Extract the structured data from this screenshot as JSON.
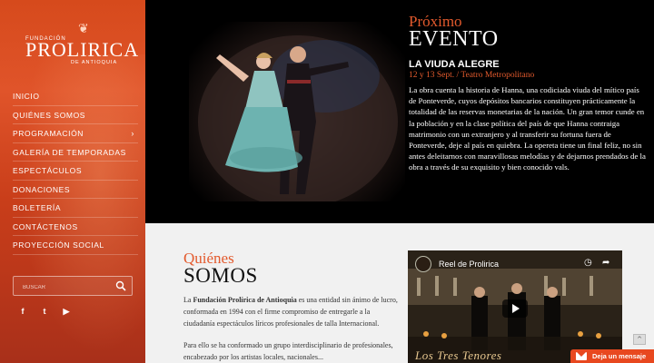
{
  "colors": {
    "accent": "#e35a2d",
    "sidebar": "#d64a1c",
    "event_bg": "#000000",
    "about_bg": "#f1f1f1"
  },
  "logo": {
    "top": "FUNDACIÓN",
    "main": "PROLIRICA",
    "sub": "DE ANTIOQUIA",
    "icon": "theatre-mask-icon"
  },
  "nav": {
    "items": [
      {
        "label": "INICIO"
      },
      {
        "label": "QUIÉNES SOMOS"
      },
      {
        "label": "PROGRAMACIÓN",
        "chevron": "›"
      },
      {
        "label": "GALERÍA DE TEMPORADAS"
      },
      {
        "label": "ESPECTÁCULOS"
      },
      {
        "label": "DONACIONES"
      },
      {
        "label": "BOLETERÍA"
      },
      {
        "label": "CONTÁCTENOS"
      },
      {
        "label": "PROYECCIÓN SOCIAL"
      }
    ]
  },
  "search": {
    "placeholder": "BUSCAR",
    "icon": "search-icon"
  },
  "social": {
    "facebook": "f",
    "twitter": "t",
    "youtube": "▶"
  },
  "event": {
    "kicker": "Próximo",
    "title": "EVENTO",
    "name": "LA VIUDA ALEGRE",
    "date": "12 y 13 Sept. / Teatro Metropolitano",
    "description": "La obra cuenta la historia de Hanna, una codiciada viuda del mítico país de Ponteverde, cuyos depósitos bancarios constituyen prácticamente la totalidad de las reservas monetarias de la nación. Un gran temor cunde en la población y en la clase política del país de que Hanna contraiga matrimonio con un extranjero y al transferir su fortuna fuera de Ponteverde, deje al país en quiebra. La opereta tiene un final feliz, no sin antes deleitarnos con maravillosas melodías y de dejarnos prendados de la obra a través de su exquisito y bien conocido vals."
  },
  "about": {
    "kicker": "Quiénes",
    "title": "SOMOS",
    "text_pre": "La ",
    "text_bold": "Fundación Prolírica de Antioquia",
    "text_post": " es una entidad sin ánimo de lucro, conformada en 1994 con el firme compromiso de entregarle a la ciudadanía espectáculos líricos profesionales de talla Internacional.",
    "text2": "Para ello se ha conformado un grupo interdisciplinario de profesionales, encabezado por los artistas locales, nacionales..."
  },
  "video": {
    "title": "Reel de Prolirica",
    "caption": "Los Tres Tenores",
    "clock_icon": "◷",
    "share_icon": "➦"
  },
  "floating": {
    "to_top": "^",
    "message_label": "Deja un mensaje"
  }
}
